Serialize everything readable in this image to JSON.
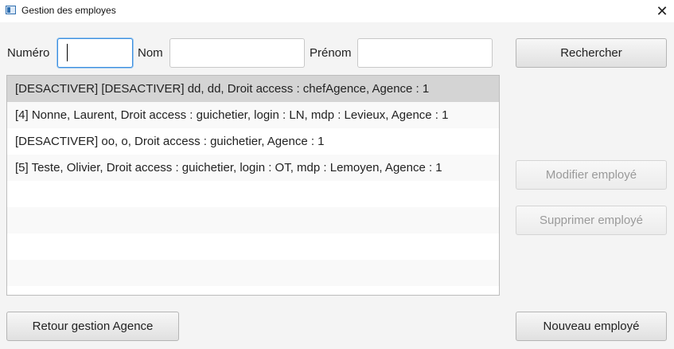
{
  "window": {
    "title": "Gestion des employes",
    "close_glyph": "✕"
  },
  "search": {
    "numero_label": "Numéro",
    "numero_value": "",
    "nom_label": "Nom",
    "nom_value": "",
    "prenom_label": "Prénom",
    "prenom_value": "",
    "search_button": "Rechercher"
  },
  "employees": [
    "[DESACTIVER] [DESACTIVER] dd, dd, Droit access : chefAgence, Agence : 1",
    "[4] Nonne, Laurent, Droit access : guichetier, login : LN, mdp : Levieux, Agence : 1",
    "[DESACTIVER] oo, o, Droit access : guichetier, Agence : 1",
    "[5] Teste, Olivier, Droit access : guichetier, login : OT, mdp : Lemoyen, Agence : 1"
  ],
  "actions": {
    "modify": "Modifier employé",
    "delete": "Supprimer employé",
    "back": "Retour gestion Agence",
    "new": "Nouveau employé"
  }
}
